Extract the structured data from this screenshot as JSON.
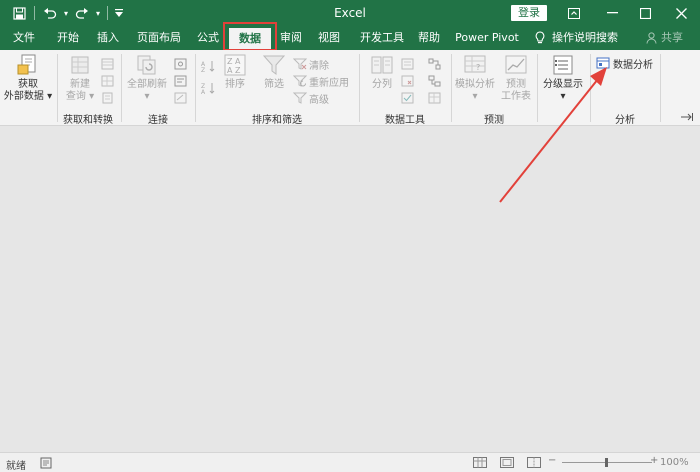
{
  "app": {
    "title": "Excel",
    "login_label": "登录"
  },
  "qat": {
    "save": "save-icon",
    "undo": "undo-icon",
    "redo": "redo-icon",
    "customize": "customize-icon"
  },
  "tabs": [
    "文件",
    "开始",
    "插入",
    "页面布局",
    "公式",
    "数据",
    "审阅",
    "视图",
    "开发工具",
    "帮助",
    "Power Pivot"
  ],
  "active_tab": "数据",
  "tell_me": "操作说明搜索",
  "share_label": "共享",
  "ribbon": {
    "get_external": {
      "line1": "获取",
      "line2": "外部数据"
    },
    "new_query": {
      "line1": "新建",
      "line2": "查询"
    },
    "refresh_all": "全部刷新",
    "sort": "排序",
    "filter": "筛选",
    "clear": "清除",
    "reapply": "重新应用",
    "advanced": "高级",
    "text_to_columns": "分列",
    "what_if": "模拟分析",
    "forecast": {
      "line1": "预测",
      "line2": "工作表"
    },
    "outline": "分级显示",
    "data_analysis": "数据分析",
    "groups": {
      "get_transform": "获取和转换",
      "connections": "连接",
      "sort_filter": "排序和筛选",
      "data_tools": "数据工具",
      "forecast": "预测",
      "analysis": "分析"
    }
  },
  "status": {
    "ready": "就绪",
    "zoom": "100%"
  },
  "colors": {
    "brand": "#217346",
    "highlight": "#e2413a"
  }
}
